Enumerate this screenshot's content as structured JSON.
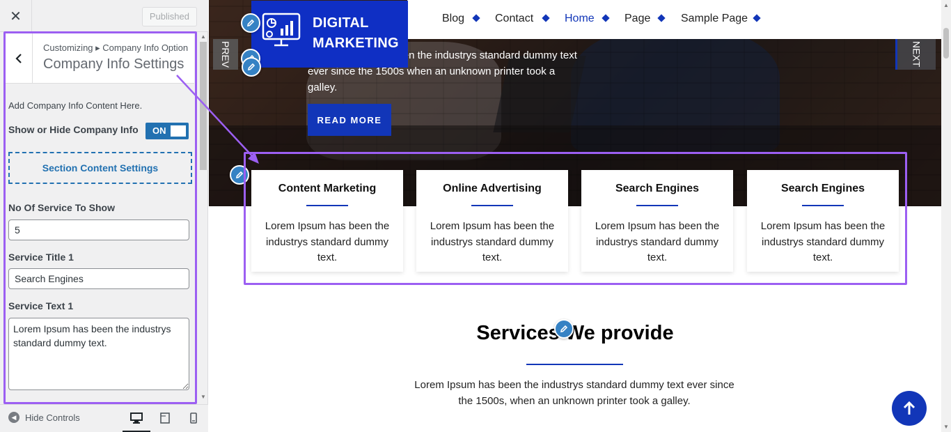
{
  "sidebar": {
    "close_label": "✕",
    "published_label": "Published",
    "breadcrumb": "Customizing ▸ Company Info Option",
    "panel_title": "Company Info Settings",
    "description": "Add Company Info Content Here.",
    "toggle_label": "Show or Hide Company Info",
    "toggle_state": "ON",
    "section_box_label": "Section Content Settings",
    "fields": {
      "count_label": "No Of Service To Show",
      "count_value": "5",
      "title_label": "Service Title 1",
      "title_value": "Search Engines",
      "text_label": "Service Text 1",
      "text_value": "Lorem Ipsum has been the industrys standard dummy text."
    },
    "footer": {
      "hide_controls": "Hide Controls"
    }
  },
  "site": {
    "logo_line1": "DIGITAL",
    "logo_line2": "MARKETING",
    "nav": [
      "Blog",
      "Contact",
      "Home",
      "Page",
      "Sample Page"
    ],
    "active_nav": "Home",
    "prev_label": "PREV",
    "next_label": "NEXT",
    "hero_text": "Lorem Ipsum has been the industrys standard dummy text ever since the 1500s when an unknown printer took a galley.",
    "read_more": "READ MORE",
    "cards": [
      {
        "title": "Content Marketing",
        "text": "Lorem Ipsum has been the industrys standard dummy text."
      },
      {
        "title": "Online Advertising",
        "text": "Lorem Ipsum has been the industrys standard dummy text."
      },
      {
        "title": "Search Engines",
        "text": "Lorem Ipsum has been the industrys standard dummy text."
      },
      {
        "title": "Search Engines",
        "text": "Lorem Ipsum has been the industrys standard dummy text."
      }
    ],
    "services_title": "Services We provide",
    "services_text": "Lorem Ipsum has been the industrys standard dummy text ever since the 1500s, when an unknown printer took a galley."
  },
  "colors": {
    "brand_blue": "#1236b8",
    "wp_blue": "#2271b1",
    "highlight_purple": "#9c5ff2"
  },
  "icons": [
    "close-icon",
    "back-chevron-icon",
    "search-icon",
    "pencil-edit-icon",
    "desktop-icon",
    "tablet-icon",
    "mobile-icon",
    "arrow-up-icon",
    "hide-controls-icon",
    "logo-chart-icon"
  ]
}
